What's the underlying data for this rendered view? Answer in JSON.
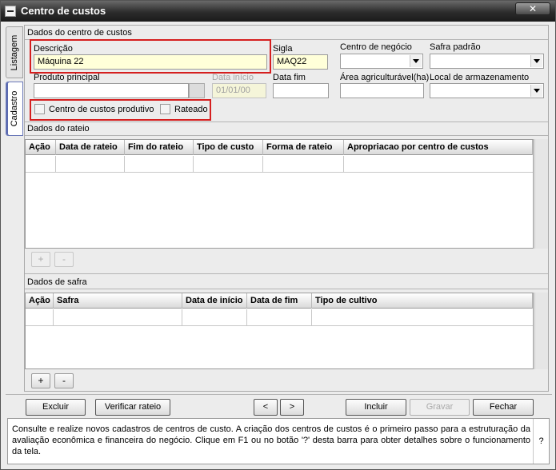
{
  "window": {
    "title": "Centro de custos",
    "close": "✕"
  },
  "tabs": {
    "listagem": "Listagem",
    "cadastro": "Cadastro"
  },
  "sections": {
    "dados_centro": "Dados do centro de custos",
    "dados_rateio": "Dados do rateio",
    "dados_safra": "Dados de safra"
  },
  "fields": {
    "descricao": {
      "label": "Descrição",
      "value": "Máquina 22"
    },
    "sigla": {
      "label": "Sigla",
      "value": "MAQ22"
    },
    "centro_negocio": {
      "label": "Centro de negócio",
      "value": ""
    },
    "safra_padrao": {
      "label": "Safra padrão",
      "value": ""
    },
    "produto_principal": {
      "label": "Produto principal",
      "value": ""
    },
    "data_inicio": {
      "label": "Data início",
      "value": "01/01/00"
    },
    "data_fim": {
      "label": "Data fim",
      "value": ""
    },
    "area_agricultavel": {
      "label": "Área agriculturável(ha)",
      "value": ""
    },
    "local_armazenamento": {
      "label": "Local de armazenamento",
      "value": ""
    }
  },
  "checkboxes": {
    "centro_produtivo": "Centro de custos produtivo",
    "rateado": "Rateado"
  },
  "rateio_columns": [
    "Ação",
    "Data de rateio",
    "Fim do rateio",
    "Tipo de custo",
    "Forma de rateio",
    "Apropriacao por centro de custos"
  ],
  "safra_columns": [
    "Ação",
    "Safra",
    "Data de início",
    "Data de fim",
    "Tipo de cultivo"
  ],
  "grid_buttons": {
    "add": "+",
    "remove": "-"
  },
  "buttons": {
    "excluir": "Excluir",
    "verificar_rateio": "Verificar rateio",
    "prev": "<",
    "next": ">",
    "incluir": "Incluir",
    "gravar": "Gravar",
    "fechar": "Fechar"
  },
  "help": {
    "text": "Consulte e realize novos cadastros de centros de custo. A criação dos centros de custos é o primeiro passo para a estruturação da avaliação econômica e financeira do negócio. Clique em F1 ou no botão '?' desta barra para obter detalhes sobre o funcionamento da tela.",
    "question": "?"
  }
}
